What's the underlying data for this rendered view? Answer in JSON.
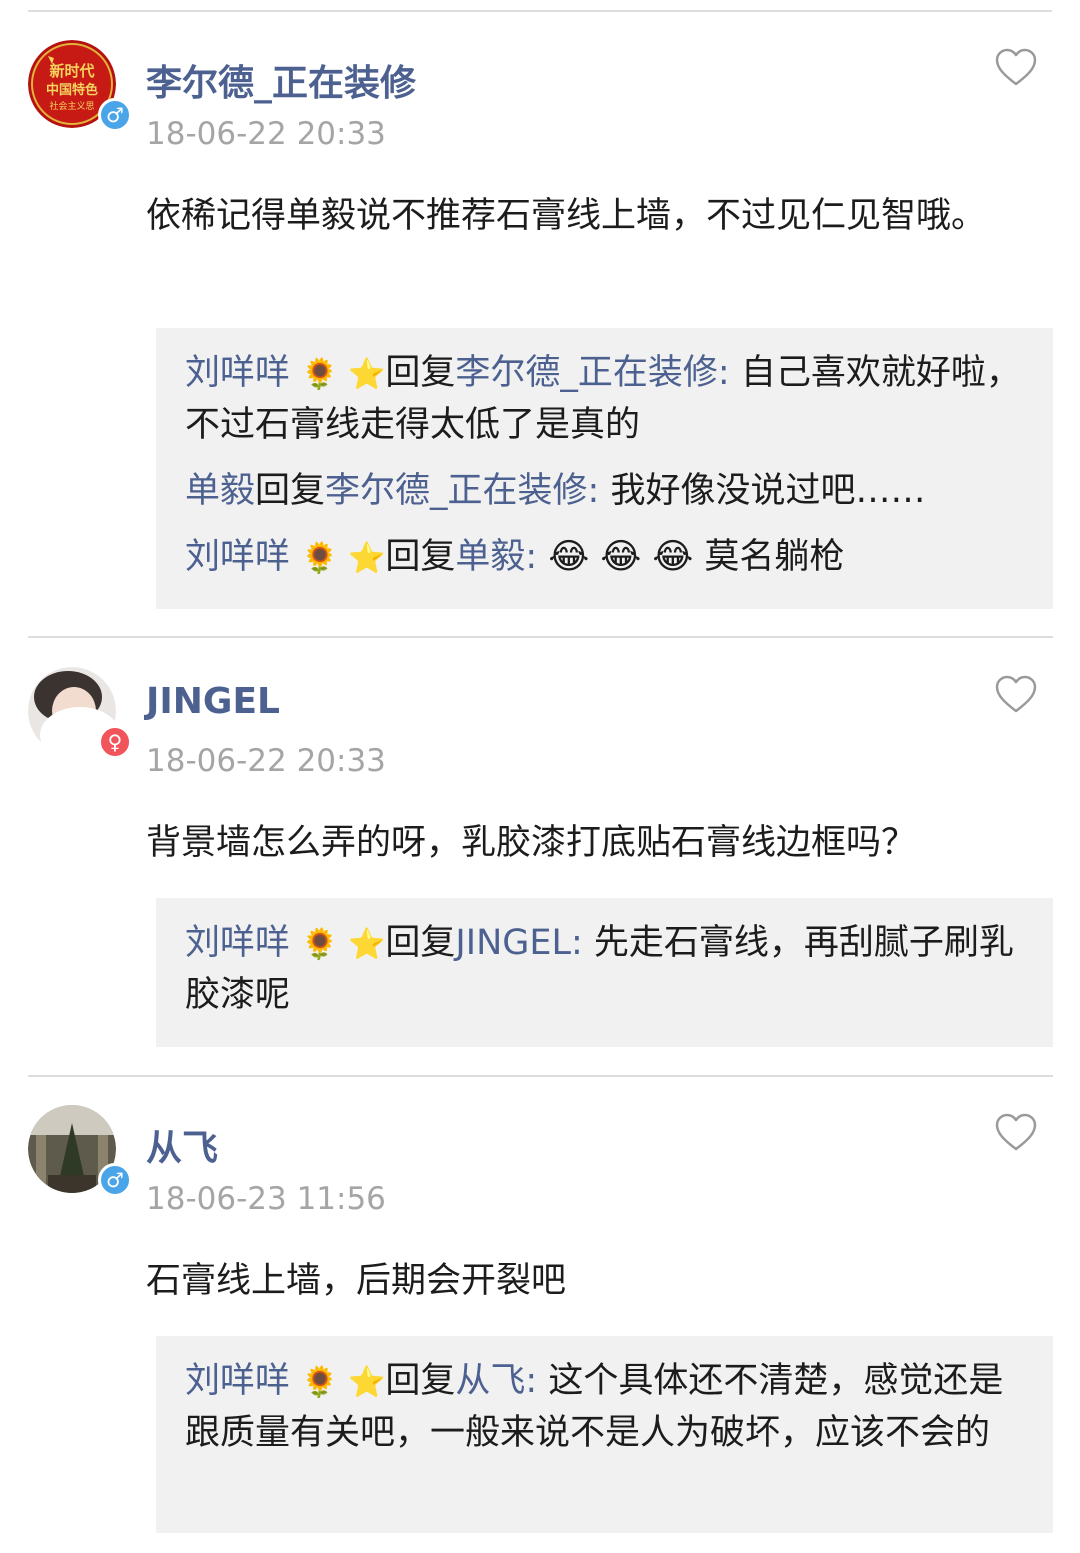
{
  "comments": [
    {
      "name": "李尔德_正在装修",
      "gender": "male",
      "time": "18-06-22 20:33",
      "text": "依稀记得单毅说不推荐石膏线上墙，不过见仁见智哦。",
      "avatar_text": [
        "新时代",
        "中国特色",
        "社会主义思"
      ],
      "replies": [
        {
          "from": "刘咩咩",
          "badges": "🌻 ⭐",
          "reply_word": "回复",
          "to": "李尔德_正在装修:",
          "text": " 自己喜欢就好啦，不过石膏线走得太低了是真的"
        },
        {
          "from": "单毅",
          "badges": "",
          "reply_word": "回复",
          "to": "李尔德_正在装修:",
          "text": " 我好像没说过吧……"
        },
        {
          "from": "刘咩咩",
          "badges": "🌻 ⭐",
          "reply_word": "回复",
          "to": "单毅:",
          "text": " 😂 😂 😂 莫名躺枪"
        }
      ]
    },
    {
      "name": "JINGEL",
      "gender": "female",
      "time": "18-06-22 20:33",
      "text": "背景墙怎么弄的呀，乳胶漆打底贴石膏线边框吗？",
      "replies": [
        {
          "from": "刘咩咩",
          "badges": "🌻 ⭐",
          "reply_word": "回复",
          "to": "JINGEL:",
          "text": " 先走石膏线，再刮腻子刷乳胶漆呢"
        }
      ]
    },
    {
      "name": "从飞",
      "gender": "male",
      "time": "18-06-23 11:56",
      "text": "石膏线上墙，后期会开裂吧",
      "replies": [
        {
          "from": "刘咩咩",
          "badges": "🌻 ⭐",
          "reply_word": "回复",
          "to": "从飞:",
          "text": " 这个具体还不清楚，感觉还是跟质量有关吧，一般来说不是人为破坏，应该不会的"
        }
      ]
    }
  ],
  "icons": {
    "like": "heart-outline-icon",
    "male": "male-symbol-icon",
    "female": "female-symbol-icon"
  },
  "colors": {
    "name": "#4d6190",
    "time": "#a5a5a5",
    "reply_bg": "#f1f1f1",
    "male": "#4aa5e8",
    "female": "#f2545b"
  }
}
